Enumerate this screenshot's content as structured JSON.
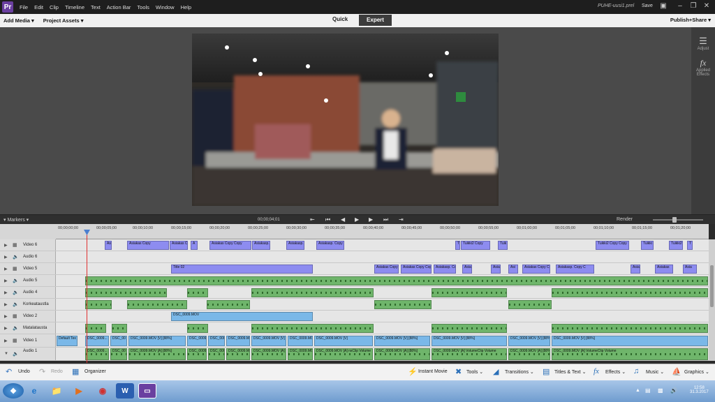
{
  "menubar": {
    "logo": "Pr",
    "items": [
      "File",
      "Edit",
      "Clip",
      "Timeline",
      "Text",
      "Action Bar",
      "Tools",
      "Window",
      "Help"
    ],
    "file_name": "PUHE-uusi1.prel",
    "save_label": "Save"
  },
  "toolbar": {
    "add_media": "Add Media ▾",
    "project_assets": "Project Assets ▾",
    "mode_quick": "Quick",
    "mode_expert": "Expert",
    "publish": "Publish+Share ▾"
  },
  "right_panel": {
    "adjust": "Adjust",
    "applied_effects": "Applied Effects"
  },
  "timeline_header": {
    "markers": "▾  Markers  ▾",
    "timecode": "00;00;04;01",
    "render": "Render"
  },
  "ruler": {
    "ticks": [
      "00;00;00;00",
      "00;00;05;00",
      "00;00;10;00",
      "00;00;15;00",
      "00;00;20;00",
      "00;00;25;00",
      "00;00;30;00",
      "00;00;35;00",
      "00;00;40;00",
      "00;00;45;00",
      "00;00;50;00",
      "00;00;55;00",
      "00;01;00;00",
      "00;01;05;00",
      "00;01;10;00",
      "00;01;15;00",
      "00;01;20;00"
    ]
  },
  "tracks": [
    {
      "name": "Video 6",
      "kind": "video"
    },
    {
      "name": "Audio 6",
      "kind": "audio"
    },
    {
      "name": "Video 5",
      "kind": "video"
    },
    {
      "name": "Audio 5",
      "kind": "audio"
    },
    {
      "name": "Audio 4",
      "kind": "audio"
    },
    {
      "name": "Korkeataustla",
      "kind": "audio"
    },
    {
      "name": "Video 2",
      "kind": "video"
    },
    {
      "name": "Matalatausta",
      "kind": "audio"
    },
    {
      "name": "Video 1",
      "kind": "video"
    },
    {
      "name": "Audio 1",
      "kind": "audio"
    }
  ],
  "clips": {
    "video6": [
      "As",
      "Asiakas Copy",
      "Asiakas C",
      "A",
      "Asiakas Copy Copy",
      "Asiakasp.",
      "Asiakasp.",
      "Asiakasp. Copy",
      "T",
      "Tuikki2 Copy",
      "Tuik",
      "Tuikki2 Copy Copy",
      "Tuikki",
      "Tuikki2",
      "T"
    ],
    "video5": [
      "Title 02",
      "Asiakas Copy",
      "Asiakas Copy Copy",
      "Asiakasp. Co",
      "Asia",
      "Asia",
      "Asi",
      "Asiakas Copy Co",
      "Asiakasp. Copy C",
      "Asia",
      "Asiakas",
      "Asia"
    ],
    "video2": [
      "DSC_0009.MOV"
    ],
    "video1": [
      "Default Tex",
      "DSC_0009...",
      "DSC_00",
      "DSC_0009.MOV [V] [88%]",
      "DSC_0009.",
      "DSC_000",
      "DSC_0009.MOV [V] [88%]",
      "DSC_0009.MOV [V] [88%]",
      "DSC_0009.MO",
      "DSC_0009.MOV [V]",
      "DSC_0009.MOV [V] [88%]",
      "DSC_0009.MOV [V] [88%]",
      "DSC_0009.MOV [V] [88%]",
      "DSC_0009.MOV [V] [88%]"
    ],
    "audio1": [
      "DSC_0009...",
      "DSC_00",
      "DSC_0009.MOV [A] [88%]",
      "DSC_0009.",
      "DSC_000",
      "DSC_0009.MOV [A] [88%]",
      "DSC_0009.MOV [A]",
      "DSC_0009.MO",
      "DSC_0009.MOV [A] nsClip Volume",
      "DSC_0009.MOV [A] [88%]",
      "DSC_0009.MOV [A] VolumeClip Volume",
      "DSC_0009.MOV [A] [88%]",
      "DSC_0009.MOV [A] VolumeClip Volume"
    ]
  },
  "actionbar": {
    "undo": "Undo",
    "redo": "Redo",
    "organizer": "Organizer",
    "instant_movie": "Instant Movie",
    "tools": "Tools ⌄",
    "transitions": "Transitions ⌄",
    "titles_text": "Titles & Text ⌄",
    "effects": "Effects ⌄",
    "music": "Music ⌄",
    "graphics": "Graphics ⌄"
  },
  "taskbar": {
    "time": "12:58",
    "date": "31.3.2017"
  }
}
